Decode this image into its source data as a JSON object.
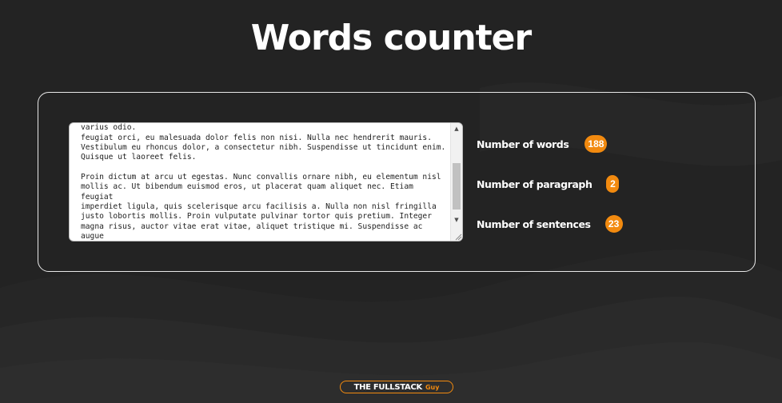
{
  "header": {
    "title": "Words counter"
  },
  "editor": {
    "text": "Curabitur vel volutpat lectus. Nunc et dui euismod, ullamcorper nisl quis, varius odio.\nfeugiat orci, eu malesuada dolor felis non nisi. Nulla nec hendrerit mauris.\nVestibulum eu rhoncus dolor, a consectetur nibh. Suspendisse ut tincidunt enim.\nQuisque ut laoreet felis.\n\nProin dictum at arcu ut egestas. Nunc convallis ornare nibh, eu elementum nisl\nmollis ac. Ut bibendum euismod eros, ut placerat quam aliquet nec. Etiam feugiat\nimperdiet ligula, quis scelerisque arcu facilisis a. Nulla non nisl fringilla\njusto lobortis mollis. Proin vulputate pulvinar tortor quis pretium. Integer\nmagna risus, auctor vitae erat vitae, aliquet tristique mi. Suspendisse ac augue\nsem. Donec consectetur arcu enim, vel placerat tortor blandit non. Vivamus\ntristique odio a turpis tempus, non pulvinar ante semper. Aenean enim lectus,\nultrices in nulla ut, vehicula dignissim nulla. Duis aliquet laoreet mattis."
  },
  "stats": [
    {
      "label": "Number of words",
      "value": "188"
    },
    {
      "label": "Number of paragraph",
      "value": "2"
    },
    {
      "label": "Number of sentences",
      "value": "23"
    }
  ],
  "footer": {
    "brand": "THE FULLSTACK",
    "brand_suffix": "Guy"
  },
  "colors": {
    "background": "#232323",
    "accent": "#f28a0f",
    "card_border": "#e8e8e8"
  },
  "icons": {
    "scroll_up": "triangle-up-icon",
    "scroll_down": "triangle-down-icon",
    "resize": "resize-grip-icon"
  }
}
